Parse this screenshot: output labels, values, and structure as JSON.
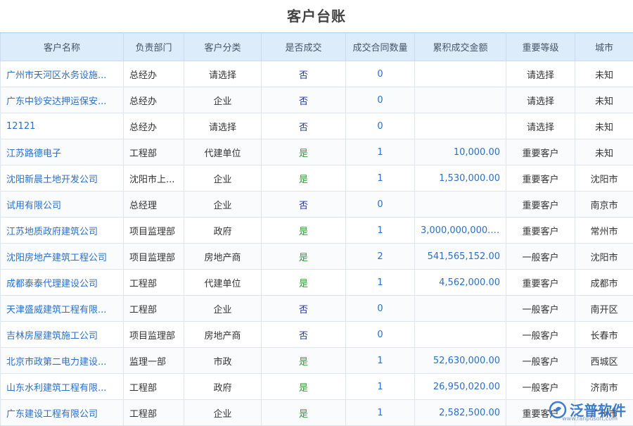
{
  "page_title": "客户台账",
  "columns": [
    "客户名称",
    "负责部门",
    "客户分类",
    "是否成交",
    "成交合同数量",
    "累积成交金额",
    "重要等级",
    "城市"
  ],
  "rows": [
    {
      "name": "广州市天河区水务设施...",
      "dept": "总经办",
      "category": "请选择",
      "deal": "否",
      "contracts": "0",
      "amount": "",
      "level": "请选择",
      "city": "未知"
    },
    {
      "name": "广东中钞安达押运保安...",
      "dept": "总经办",
      "category": "企业",
      "deal": "否",
      "contracts": "0",
      "amount": "",
      "level": "请选择",
      "city": "未知"
    },
    {
      "name": "12121",
      "dept": "总经办",
      "category": "请选择",
      "deal": "否",
      "contracts": "0",
      "amount": "",
      "level": "请选择",
      "city": "未知"
    },
    {
      "name": "江苏路德电子",
      "dept": "工程部",
      "category": "代建单位",
      "deal": "是",
      "contracts": "1",
      "amount": "10,000.00",
      "level": "重要客户",
      "city": "未知"
    },
    {
      "name": "沈阳新晨土地开发公司",
      "dept": "沈阳市上...",
      "category": "企业",
      "deal": "是",
      "contracts": "1",
      "amount": "1,530,000.00",
      "level": "重要客户",
      "city": "沈阳市"
    },
    {
      "name": "试用有限公司",
      "dept": "总经理",
      "category": "企业",
      "deal": "否",
      "contracts": "0",
      "amount": "",
      "level": "重要客户",
      "city": "南京市"
    },
    {
      "name": "江苏地质政府建筑公司",
      "dept": "项目监理部",
      "category": "政府",
      "deal": "是",
      "contracts": "1",
      "amount": "3,000,000,000.00",
      "level": "重要客户",
      "city": "常州市"
    },
    {
      "name": "沈阳房地产建筑工程公司",
      "dept": "项目监理部",
      "category": "房地产商",
      "deal": "是",
      "contracts": "2",
      "amount": "541,565,152.00",
      "level": "一般客户",
      "city": "沈阳市"
    },
    {
      "name": "成都泰泰代理建设公司",
      "dept": "工程部",
      "category": "代建单位",
      "deal": "是",
      "contracts": "1",
      "amount": "4,562,000.00",
      "level": "重要客户",
      "city": "成都市"
    },
    {
      "name": "天津盛威建筑工程有限...",
      "dept": "工程部",
      "category": "企业",
      "deal": "否",
      "contracts": "0",
      "amount": "",
      "level": "一般客户",
      "city": "南开区"
    },
    {
      "name": "吉林房屋建筑施工公司",
      "dept": "项目监理部",
      "category": "房地产商",
      "deal": "否",
      "contracts": "0",
      "amount": "",
      "level": "一般客户",
      "city": "长春市"
    },
    {
      "name": "北京市政第二电力建设...",
      "dept": "监理一部",
      "category": "市政",
      "deal": "是",
      "contracts": "1",
      "amount": "52,630,000.00",
      "level": "一般客户",
      "city": "西城区"
    },
    {
      "name": "山东水利建筑工程有限...",
      "dept": "工程部",
      "category": "政府",
      "deal": "是",
      "contracts": "1",
      "amount": "26,950,020.00",
      "level": "一般客户",
      "city": "济南市"
    },
    {
      "name": "广东建设工程有限公司",
      "dept": "工程部",
      "category": "企业",
      "deal": "是",
      "contracts": "1",
      "amount": "2,582,500.00",
      "level": "重要客户",
      "city": "广州市"
    }
  ],
  "watermark": {
    "text": "泛普软件",
    "sub": "www.fanpusoft.com"
  }
}
